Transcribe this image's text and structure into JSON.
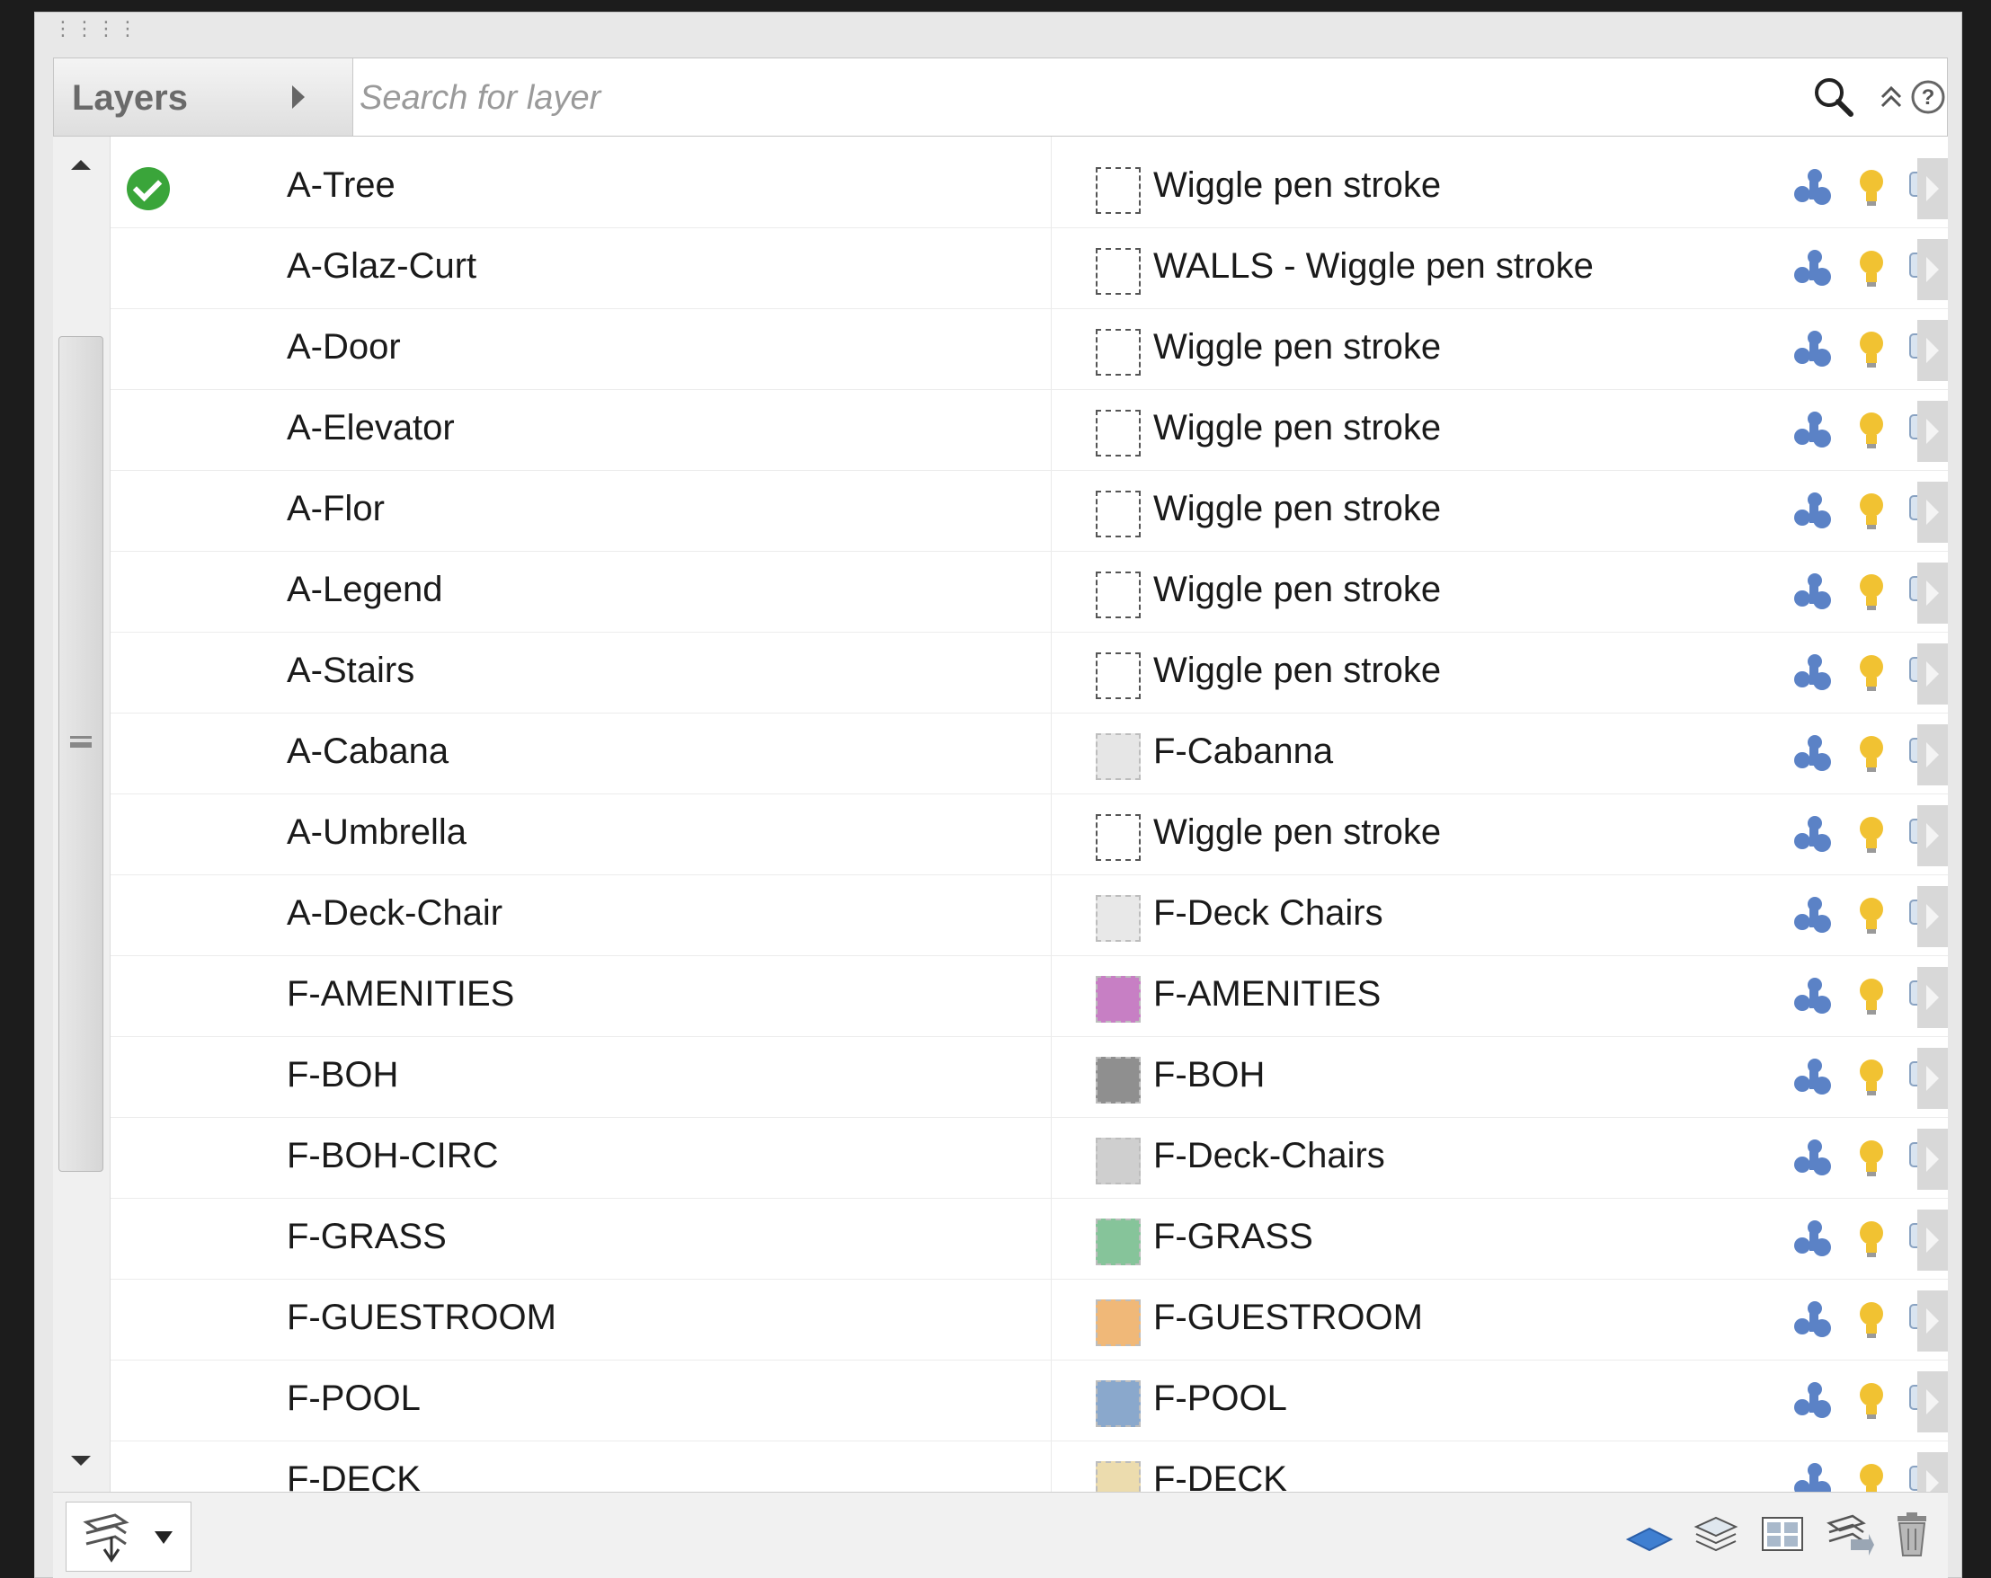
{
  "header": {
    "title": "Layers",
    "search_placeholder": "Search for layer"
  },
  "colors": {
    "active_check": "#3aa53a",
    "bulb": "#f1c232",
    "visibility_icon": "#5b82c6",
    "expand_button": "#d8d8d8"
  },
  "layers": [
    {
      "name": "A-Tree",
      "style": "Wiggle pen stroke",
      "swatch": "dashed",
      "active": true
    },
    {
      "name": "A-Glaz-Curt",
      "style": "WALLS - Wiggle pen stroke",
      "swatch": "dashed",
      "active": false
    },
    {
      "name": "A-Door",
      "style": "Wiggle pen stroke",
      "swatch": "dashed",
      "active": false
    },
    {
      "name": "A-Elevator",
      "style": "Wiggle pen stroke",
      "swatch": "dashed",
      "active": false
    },
    {
      "name": "A-Flor",
      "style": "Wiggle pen stroke",
      "swatch": "dashed",
      "active": false
    },
    {
      "name": "A-Legend",
      "style": "Wiggle pen stroke",
      "swatch": "dashed",
      "active": false
    },
    {
      "name": "A-Stairs",
      "style": "Wiggle pen stroke",
      "swatch": "dashed",
      "active": false
    },
    {
      "name": "A-Cabana",
      "style": "F-Cabanna",
      "swatch": "#e6e6e6",
      "active": false
    },
    {
      "name": "A-Umbrella",
      "style": "Wiggle pen stroke",
      "swatch": "dashed",
      "active": false
    },
    {
      "name": "A-Deck-Chair",
      "style": "F-Deck Chairs",
      "swatch": "#e8e8e8",
      "active": false
    },
    {
      "name": "F-AMENITIES",
      "style": "F-AMENITIES",
      "swatch": "#c77fc4",
      "active": false
    },
    {
      "name": "F-BOH",
      "style": "F-BOH",
      "swatch": "#8f8f8f",
      "active": false
    },
    {
      "name": "F-BOH-CIRC",
      "style": "F-Deck-Chairs",
      "swatch": "#cfcfcf",
      "active": false
    },
    {
      "name": "F-GRASS",
      "style": "F-GRASS",
      "swatch": "#86c49a",
      "active": false
    },
    {
      "name": "F-GUESTROOM",
      "style": "F-GUESTROOM",
      "swatch": "#f0b878",
      "active": false
    },
    {
      "name": "F-POOL",
      "style": "F-POOL",
      "swatch": "#8aa8cc",
      "active": false
    },
    {
      "name": "F-DECK",
      "style": "F-DECK",
      "swatch": "#ecdcae",
      "active": false
    }
  ]
}
